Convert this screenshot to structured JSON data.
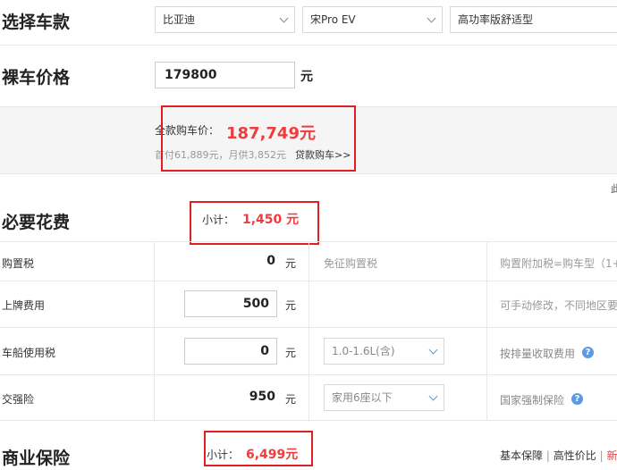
{
  "select_car": {
    "title": "选择车款",
    "brand": "比亚迪",
    "model": "宋Pro EV",
    "trim": "高功率版舒适型"
  },
  "bare_price": {
    "title": "裸车价格",
    "value": "179800",
    "unit": "元"
  },
  "full_price": {
    "label": "全款购车价：",
    "value": "187,749元",
    "loan_info": "首付61,889元，月供3,852元",
    "loan_link": "贷款购车>>",
    "side_cut": "此"
  },
  "required_fees": {
    "title": "必要花费",
    "subtotal_label": "小计：",
    "subtotal_value": "1,450 元",
    "rows": [
      {
        "name": "购置税",
        "value": "0",
        "unit": "元",
        "note": "免征购置税",
        "desc": "购置附加税=购车型（1+"
      },
      {
        "name": "上牌费用",
        "value": "500",
        "unit": "元",
        "desc": "可手动修改，不同地区要"
      },
      {
        "name": "车船使用税",
        "value": "0",
        "unit": "元",
        "option": "1.0-1.6L(含)",
        "desc": "按排量收取费用",
        "help": "?"
      },
      {
        "name": "交强险",
        "value": "950",
        "unit": "元",
        "option": "家用6座以下",
        "desc": "国家强制保险",
        "help": "?"
      }
    ]
  },
  "commercial_insurance": {
    "title": "商业保险",
    "subtotal_label": "小计：",
    "subtotal_value": "6,499元",
    "tabs": [
      "基本保障",
      "高性价比",
      "新手"
    ],
    "separator": "|"
  },
  "colors": {
    "accent_red": "#f03c3c",
    "highlight_box": "#e02020",
    "help_blue": "#5b9be6"
  }
}
